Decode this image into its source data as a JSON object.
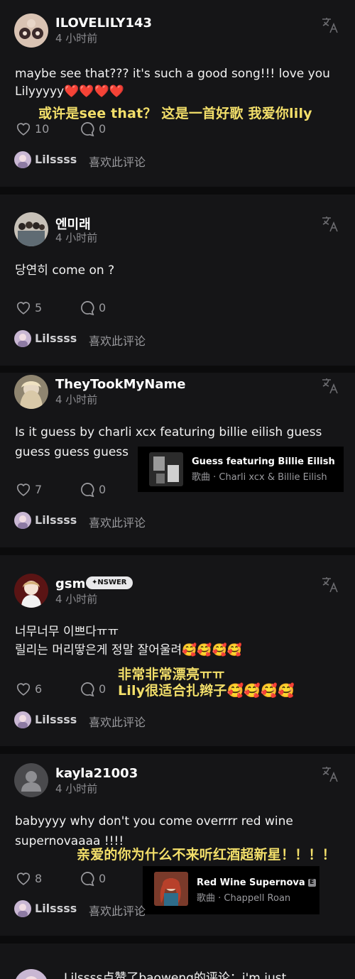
{
  "comments": [
    {
      "username": "ILOVELILY143",
      "time": "4 小时前",
      "lines": [
        "maybe see that??? it's such a good song!!! love you",
        "Lilyyyyy❤️❤️❤️❤️"
      ],
      "overlay": [
        "或许是see that？ 这是一首好歌 我爱你lily"
      ],
      "likes": "10",
      "replies": "0",
      "liker": "Lilssss",
      "liker_suffix": "喜欢此评论"
    },
    {
      "username": "엔미래",
      "time": "4 小时前",
      "lines": [
        "당연히 come on ?"
      ],
      "likes": "5",
      "replies": "0",
      "liker": "Lilssss",
      "liker_suffix": "喜欢此评论"
    },
    {
      "username": "TheyTookMyName",
      "time": "4 小时前",
      "lines": [
        "Is it guess by charli xcx featuring billie eilish guess",
        "guess guess guess"
      ],
      "song": {
        "title": "Guess featuring Billie Eilish",
        "meta": "歌曲 · Charli xcx & Billie Eilish"
      },
      "likes": "7",
      "replies": "0",
      "liker": "Lilssss",
      "liker_suffix": "喜欢此评论"
    },
    {
      "username": "gsm",
      "badge": "✦NSWER",
      "time": "4 小时前",
      "lines": [
        "너무너무 이쁘다ㅠㅠ",
        "릴리는 머리땋은게 정말 잘어울려🥰🥰🥰🥰"
      ],
      "overlay": [
        "非常非常漂亮ㅠㅠ",
        "Lily很适合扎辫子🥰🥰🥰🥰"
      ],
      "likes": "6",
      "replies": "0",
      "liker": "Lilssss",
      "liker_suffix": "喜欢此评论"
    },
    {
      "username": "kayla21003",
      "time": "4 小时前",
      "lines": [
        "babyyyy why don't you come overrrr red wine",
        "supernovaaaa !!!!"
      ],
      "overlay": [
        "亲爱的你为什么不来听红酒超新星！！！！"
      ],
      "song": {
        "title": "Red Wine Supernova",
        "explicit": "E",
        "meta": "歌曲 · Chappell Roan"
      },
      "likes": "8",
      "replies": "0",
      "liker": "Lilssss",
      "liker_suffix": "喜欢此评论"
    }
  ],
  "bottom_partial": "Lilssss点赞了baoweng的评论：i'm just",
  "colors": {
    "background": "#151517",
    "overlay_text": "#f3df6a",
    "muted": "#8a8a8e"
  },
  "icons": [
    "heart-icon",
    "comment-icon",
    "translate-icon"
  ]
}
